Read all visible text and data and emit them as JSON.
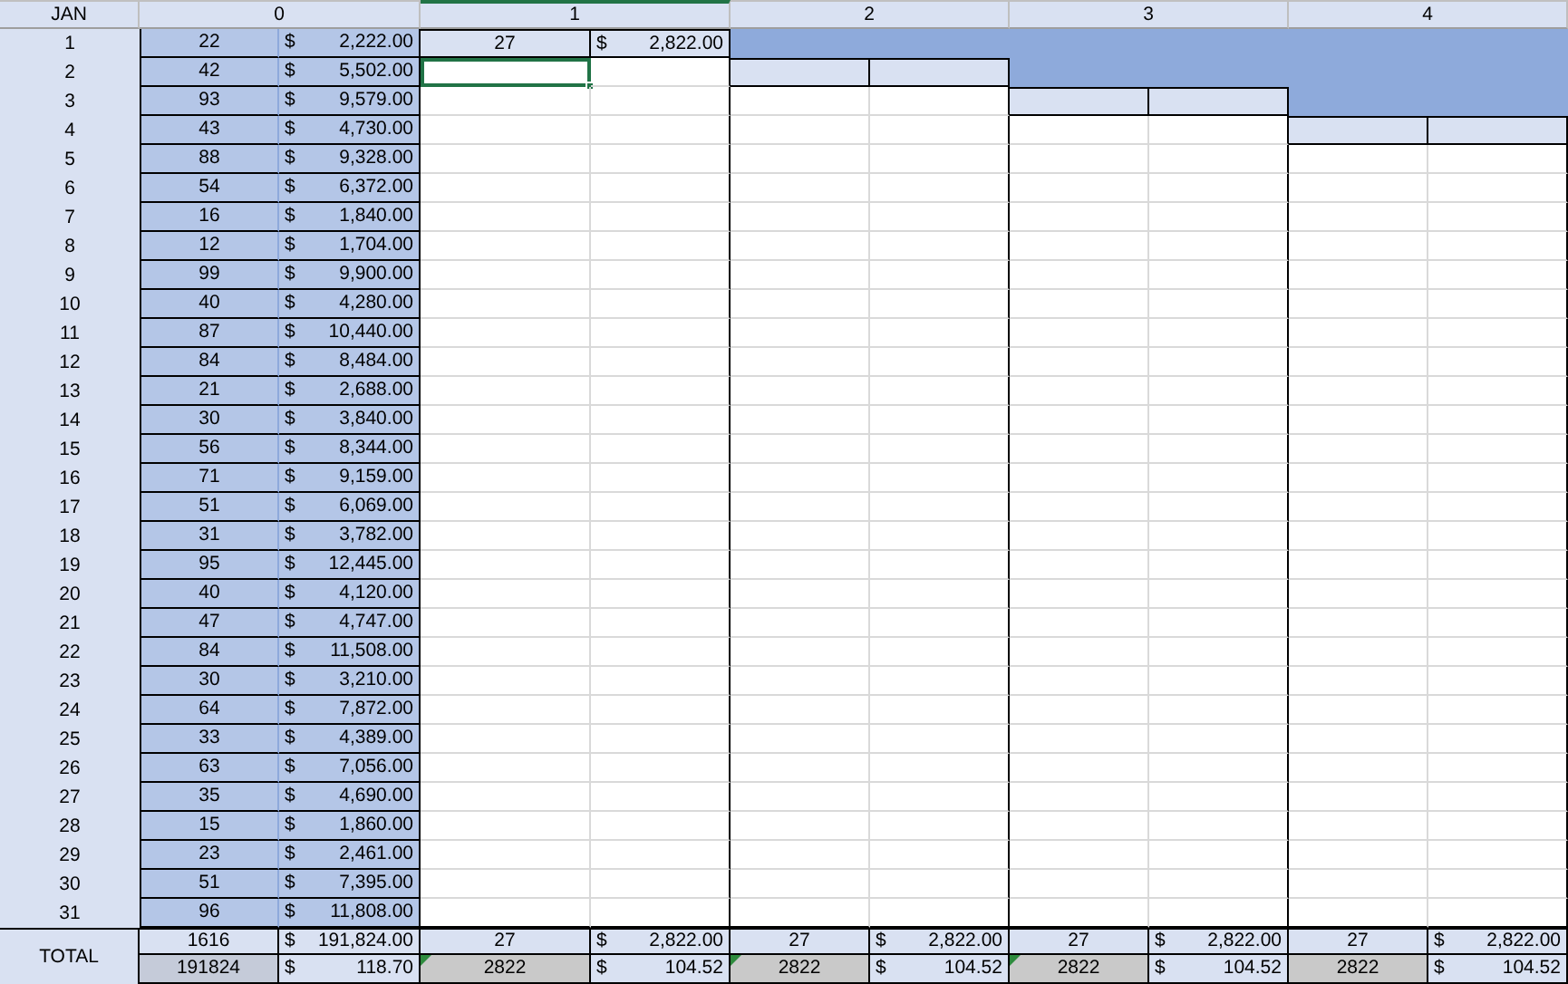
{
  "sheet": {
    "corner_label": "JAN",
    "total_label": "TOTAL",
    "days": [
      "1",
      "2",
      "3",
      "4",
      "5",
      "6",
      "7",
      "8",
      "9",
      "10",
      "11",
      "12",
      "13",
      "14",
      "15",
      "16",
      "17",
      "18",
      "19",
      "20",
      "21",
      "22",
      "23",
      "24",
      "25",
      "26",
      "27",
      "28",
      "29",
      "30",
      "31"
    ],
    "groups": [
      {
        "kind": "daily",
        "label": "0",
        "selected": false,
        "rows": [
          [
            "22",
            "$",
            "2,222.00"
          ],
          [
            "42",
            "$",
            "5,502.00"
          ],
          [
            "93",
            "$",
            "9,579.00"
          ],
          [
            "43",
            "$",
            "4,730.00"
          ],
          [
            "88",
            "$",
            "9,328.00"
          ],
          [
            "54",
            "$",
            "6,372.00"
          ],
          [
            "16",
            "$",
            "1,840.00"
          ],
          [
            "12",
            "$",
            "1,704.00"
          ],
          [
            "99",
            "$",
            "9,900.00"
          ],
          [
            "40",
            "$",
            "4,280.00"
          ],
          [
            "87",
            "$",
            "10,440.00"
          ],
          [
            "84",
            "$",
            "8,484.00"
          ],
          [
            "21",
            "$",
            "2,688.00"
          ],
          [
            "30",
            "$",
            "3,840.00"
          ],
          [
            "56",
            "$",
            "8,344.00"
          ],
          [
            "71",
            "$",
            "9,159.00"
          ],
          [
            "51",
            "$",
            "6,069.00"
          ],
          [
            "31",
            "$",
            "3,782.00"
          ],
          [
            "95",
            "$",
            "12,445.00"
          ],
          [
            "40",
            "$",
            "4,120.00"
          ],
          [
            "47",
            "$",
            "4,747.00"
          ],
          [
            "84",
            "$",
            "11,508.00"
          ],
          [
            "30",
            "$",
            "3,210.00"
          ],
          [
            "64",
            "$",
            "7,872.00"
          ],
          [
            "33",
            "$",
            "4,389.00"
          ],
          [
            "63",
            "$",
            "7,056.00"
          ],
          [
            "35",
            "$",
            "4,690.00"
          ],
          [
            "15",
            "$",
            "1,860.00"
          ],
          [
            "23",
            "$",
            "2,461.00"
          ],
          [
            "51",
            "$",
            "7,395.00"
          ],
          [
            "96",
            "$",
            "11,808.00"
          ]
        ],
        "total": {
          "qty": "1616",
          "currency": "$",
          "amount": "191,824.00",
          "sum": "191824",
          "avg_currency": "$",
          "avg": "118.70",
          "flagged": false
        }
      },
      {
        "kind": "single",
        "label": "1",
        "selected": true,
        "entry": {
          "qty": "27",
          "currency": "$",
          "amount": "2,822.00"
        },
        "total": {
          "qty": "27",
          "currency": "$",
          "amount": "2,822.00",
          "sum": "2822",
          "avg_currency": "$",
          "avg": "104.52",
          "flagged": true
        }
      },
      {
        "kind": "single",
        "label": "2",
        "selected": false,
        "total": {
          "qty": "27",
          "currency": "$",
          "amount": "2,822.00",
          "sum": "2822",
          "avg_currency": "$",
          "avg": "104.52",
          "flagged": true
        }
      },
      {
        "kind": "single",
        "label": "3",
        "selected": false,
        "total": {
          "qty": "27",
          "currency": "$",
          "amount": "2,822.00",
          "sum": "2822",
          "avg_currency": "$",
          "avg": "104.52",
          "flagged": true
        }
      },
      {
        "kind": "single",
        "label": "4",
        "selected": false,
        "total": {
          "qty": "27",
          "currency": "$",
          "amount": "2,822.00",
          "sum": "2822",
          "avg_currency": "$",
          "avg": "104.52",
          "flagged": false
        }
      }
    ]
  }
}
